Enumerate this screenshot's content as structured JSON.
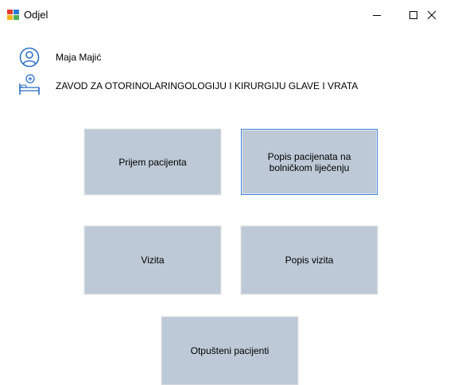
{
  "window": {
    "title": "Odjel",
    "minimize_glyph": "—",
    "maximize_glyph": "☐",
    "close_glyph": "✕"
  },
  "user": {
    "name": "Maja Majić",
    "icon": "user-circle-icon"
  },
  "department": {
    "name": "ZAVOD ZA OTORINOLARINGOLOGIJU I KIRURGIJU GLAVE I VRATA",
    "icon": "hospital-bed-icon"
  },
  "tiles": [
    {
      "label": "Prijem pacijenta"
    },
    {
      "label": "Popis pacijenata na bolničkom liječenju"
    },
    {
      "label": "Vizita"
    },
    {
      "label": "Popis vizita"
    },
    {
      "label": "Otpušteni pacijenti"
    }
  ],
  "colors": {
    "tile_background": "#bdc9d6",
    "focus_border": "#3b7bd8",
    "icon_blue": "#2f6fc6"
  }
}
